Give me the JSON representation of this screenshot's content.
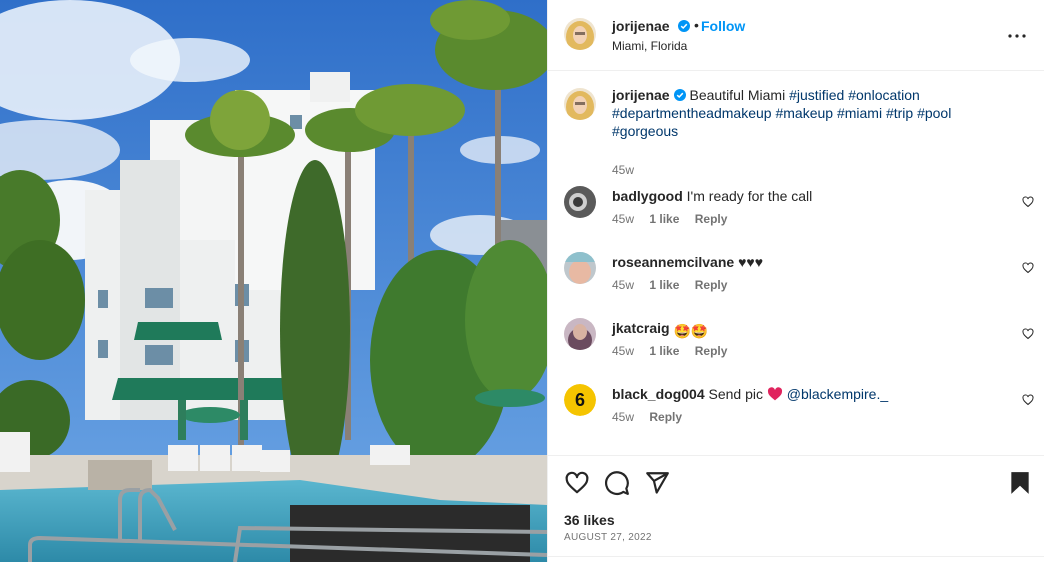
{
  "post": {
    "author": {
      "username": "jorijenae",
      "location": "Miami, Florida",
      "follow_label": "Follow",
      "separator": "•",
      "verified_icon": "verified-badge-icon"
    },
    "caption": {
      "username": "jorijenae",
      "text": "Beautiful Miami",
      "hashtags": [
        "#justified",
        "#onlocation",
        "#departmentheadmakeup",
        "#makeup",
        "#miami",
        "#trip",
        "#pool",
        "#gorgeous"
      ],
      "time": "45w"
    },
    "comments": [
      {
        "username": "badlygood",
        "text": "I'm ready for the call",
        "time": "45w",
        "likes": "1 like",
        "reply": "Reply"
      },
      {
        "username": "roseannemcilvane",
        "text": "♥♥♥",
        "time": "45w",
        "likes": "1 like",
        "reply": "Reply"
      },
      {
        "username": "jkatcraig",
        "text": "🤩🤩",
        "time": "45w",
        "likes": "1 like",
        "reply": "Reply"
      },
      {
        "username": "black_dog004",
        "text": "Send pic",
        "mention": "@blackempire._",
        "time": "45w",
        "reply": "Reply"
      }
    ],
    "likes": "36 likes",
    "date": "AUGUST 27, 2022",
    "icons": {
      "more": "more-options-icon",
      "like": "heart-icon",
      "comment": "comment-icon",
      "share": "share-icon",
      "save": "bookmark-icon"
    },
    "colors": {
      "link": "#0095f6",
      "hashtag": "#00376b",
      "muted": "#737373",
      "text": "#262626",
      "sky": "#3a7fd4"
    }
  }
}
